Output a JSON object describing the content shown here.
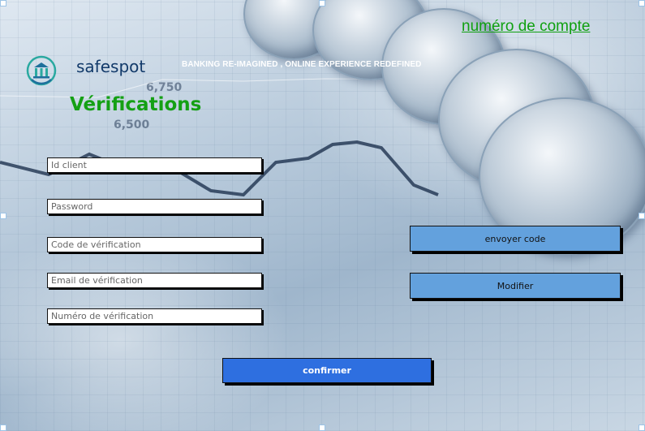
{
  "header": {
    "account_link": "numéro de compte",
    "brand": "safespot",
    "tagline": "BANKING RE-IMAGINED , ONLINE EXPERIENCE REDEFINED",
    "title": "Vérifications",
    "logo_icon": "bank-building-chart-icon"
  },
  "form": {
    "client_id": {
      "placeholder": "Id client",
      "value": ""
    },
    "password": {
      "placeholder": "Password",
      "value": ""
    },
    "verification_code": {
      "placeholder": "Code de vérification",
      "value": ""
    },
    "verification_email": {
      "placeholder": "Email de vérification",
      "value": ""
    },
    "verification_number": {
      "placeholder": "Numéro de vérification",
      "value": ""
    }
  },
  "buttons": {
    "send_code": "envoyer code",
    "modify": "Modifier",
    "confirm": "confirmer"
  },
  "colors": {
    "title_green": "#14a014",
    "brand_navy": "#123a6a",
    "button_light_blue": "#63a1dd",
    "button_primary_blue": "#2e6fe0"
  }
}
